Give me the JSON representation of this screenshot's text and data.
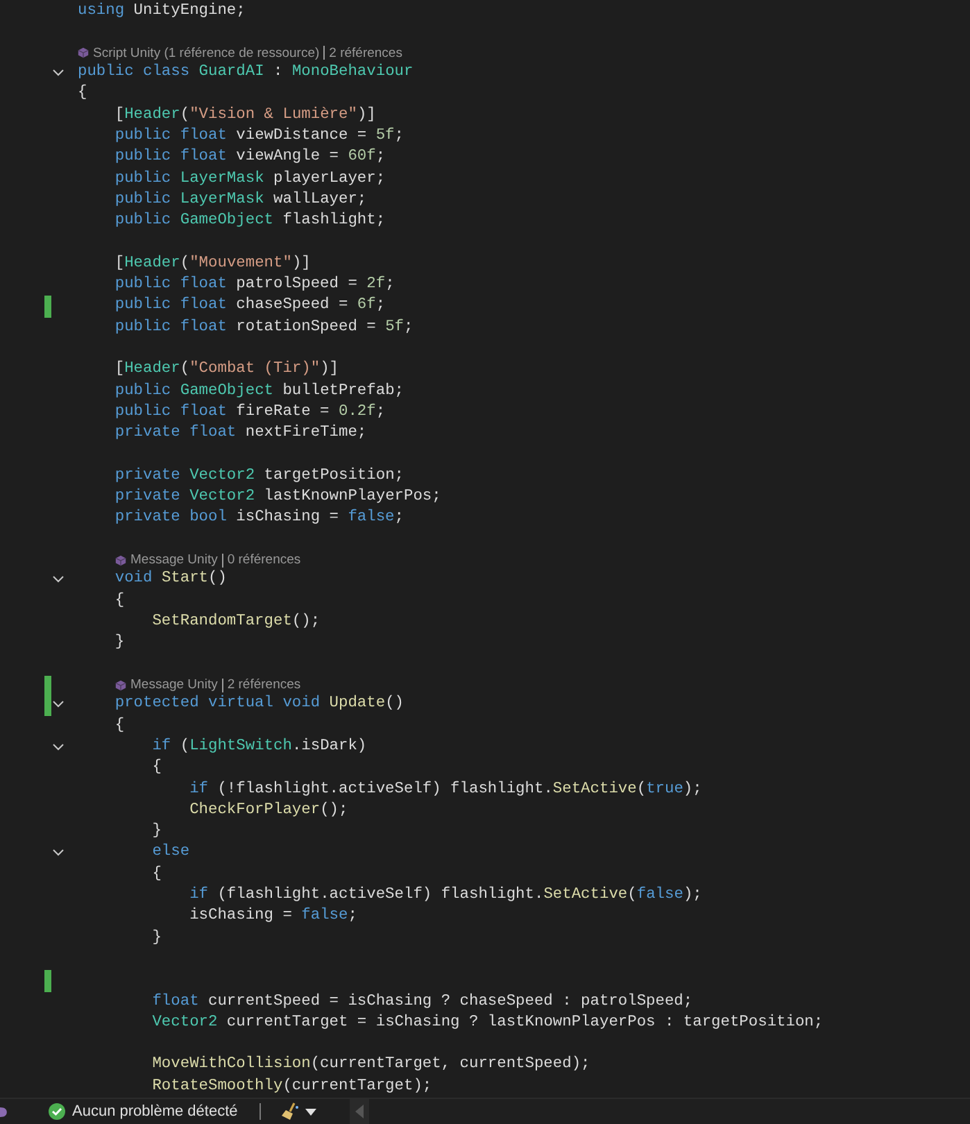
{
  "editor": {
    "lines": [
      {
        "kind": "code",
        "t": [
          {
            "kind": "kw",
            "text": "using"
          },
          {
            "kind": "text",
            "text": " UnityEngine;"
          }
        ]
      },
      {
        "kind": "blank"
      },
      {
        "kind": "lens",
        "parts": [
          "Script Unity (1 référence de ressource)",
          "2 références"
        ]
      },
      {
        "kind": "code",
        "fold": true,
        "t": [
          {
            "kind": "kw",
            "text": "public class "
          },
          {
            "kind": "type",
            "text": "GuardAI"
          },
          {
            "kind": "text",
            "text": " : "
          },
          {
            "kind": "type",
            "text": "MonoBehaviour"
          }
        ]
      },
      {
        "kind": "code",
        "t": [
          {
            "kind": "text",
            "text": "{"
          }
        ]
      },
      {
        "kind": "code",
        "t": [
          {
            "kind": "text",
            "text": "    ["
          },
          {
            "kind": "type",
            "text": "Header"
          },
          {
            "kind": "text",
            "text": "("
          },
          {
            "kind": "str",
            "text": "\"Vision & Lumière\""
          },
          {
            "kind": "text",
            "text": ")]"
          }
        ]
      },
      {
        "kind": "code",
        "t": [
          {
            "kind": "kw",
            "text": "    public float"
          },
          {
            "kind": "text",
            "text": " viewDistance = "
          },
          {
            "kind": "num",
            "text": "5f"
          },
          {
            "kind": "text",
            "text": ";"
          }
        ]
      },
      {
        "kind": "code",
        "t": [
          {
            "kind": "kw",
            "text": "    public float"
          },
          {
            "kind": "text",
            "text": " viewAngle = "
          },
          {
            "kind": "num",
            "text": "60f"
          },
          {
            "kind": "text",
            "text": ";"
          }
        ]
      },
      {
        "kind": "code",
        "t": [
          {
            "kind": "kw",
            "text": "    public "
          },
          {
            "kind": "type",
            "text": "LayerMask"
          },
          {
            "kind": "text",
            "text": " playerLayer;"
          }
        ]
      },
      {
        "kind": "code",
        "t": [
          {
            "kind": "kw",
            "text": "    public "
          },
          {
            "kind": "type",
            "text": "LayerMask"
          },
          {
            "kind": "text",
            "text": " wallLayer;"
          }
        ]
      },
      {
        "kind": "code",
        "t": [
          {
            "kind": "kw",
            "text": "    public "
          },
          {
            "kind": "type",
            "text": "GameObject"
          },
          {
            "kind": "text",
            "text": " flashlight;"
          }
        ]
      },
      {
        "kind": "blank"
      },
      {
        "kind": "code",
        "t": [
          {
            "kind": "text",
            "text": "    ["
          },
          {
            "kind": "type",
            "text": "Header"
          },
          {
            "kind": "text",
            "text": "("
          },
          {
            "kind": "str",
            "text": "\"Mouvement\""
          },
          {
            "kind": "text",
            "text": ")]"
          }
        ]
      },
      {
        "kind": "code",
        "t": [
          {
            "kind": "kw",
            "text": "    public float"
          },
          {
            "kind": "text",
            "text": " patrolSpeed = "
          },
          {
            "kind": "num",
            "text": "2f"
          },
          {
            "kind": "text",
            "text": ";"
          }
        ]
      },
      {
        "kind": "code",
        "changed": true,
        "t": [
          {
            "kind": "kw",
            "text": "    public float"
          },
          {
            "kind": "text",
            "text": " chaseSpeed = "
          },
          {
            "kind": "num",
            "text": "6f"
          },
          {
            "kind": "text",
            "text": ";"
          }
        ]
      },
      {
        "kind": "code",
        "t": [
          {
            "kind": "kw",
            "text": "    public float"
          },
          {
            "kind": "text",
            "text": " rotationSpeed = "
          },
          {
            "kind": "num",
            "text": "5f"
          },
          {
            "kind": "text",
            "text": ";"
          }
        ]
      },
      {
        "kind": "blank"
      },
      {
        "kind": "code",
        "t": [
          {
            "kind": "text",
            "text": "    ["
          },
          {
            "kind": "type",
            "text": "Header"
          },
          {
            "kind": "text",
            "text": "("
          },
          {
            "kind": "str",
            "text": "\"Combat (Tir)\""
          },
          {
            "kind": "text",
            "text": ")]"
          }
        ]
      },
      {
        "kind": "code",
        "t": [
          {
            "kind": "kw",
            "text": "    public "
          },
          {
            "kind": "type",
            "text": "GameObject"
          },
          {
            "kind": "text",
            "text": " bulletPrefab;"
          }
        ]
      },
      {
        "kind": "code",
        "t": [
          {
            "kind": "kw",
            "text": "    public float"
          },
          {
            "kind": "text",
            "text": " fireRate = "
          },
          {
            "kind": "num",
            "text": "0.2f"
          },
          {
            "kind": "text",
            "text": ";"
          }
        ]
      },
      {
        "kind": "code",
        "t": [
          {
            "kind": "kw",
            "text": "    private float"
          },
          {
            "kind": "text",
            "text": " nextFireTime;"
          }
        ]
      },
      {
        "kind": "blank"
      },
      {
        "kind": "code",
        "t": [
          {
            "kind": "kw",
            "text": "    private "
          },
          {
            "kind": "type",
            "text": "Vector2"
          },
          {
            "kind": "text",
            "text": " targetPosition;"
          }
        ]
      },
      {
        "kind": "code",
        "t": [
          {
            "kind": "kw",
            "text": "    private "
          },
          {
            "kind": "type",
            "text": "Vector2"
          },
          {
            "kind": "text",
            "text": " lastKnownPlayerPos;"
          }
        ]
      },
      {
        "kind": "code",
        "t": [
          {
            "kind": "kw",
            "text": "    private bool"
          },
          {
            "kind": "text",
            "text": " isChasing = "
          },
          {
            "kind": "kw",
            "text": "false"
          },
          {
            "kind": "text",
            "text": ";"
          }
        ]
      },
      {
        "kind": "blank"
      },
      {
        "kind": "lens",
        "parts": [
          "Message Unity",
          "0 références"
        ]
      },
      {
        "kind": "code",
        "fold": true,
        "t": [
          {
            "kind": "kw",
            "text": "    void "
          },
          {
            "kind": "fn",
            "text": "Start"
          },
          {
            "kind": "text",
            "text": "()"
          }
        ]
      },
      {
        "kind": "code",
        "t": [
          {
            "kind": "text",
            "text": "    {"
          }
        ]
      },
      {
        "kind": "code",
        "t": [
          {
            "kind": "fn",
            "text": "        SetRandomTarget"
          },
          {
            "kind": "text",
            "text": "();"
          }
        ]
      },
      {
        "kind": "code",
        "t": [
          {
            "kind": "text",
            "text": "    }"
          }
        ]
      },
      {
        "kind": "blank"
      },
      {
        "kind": "lens",
        "changed": true,
        "parts": [
          "Message Unity",
          "2 références"
        ]
      },
      {
        "kind": "code",
        "fold": true,
        "changed": true,
        "t": [
          {
            "kind": "kw",
            "text": "    protected virtual void "
          },
          {
            "kind": "fn",
            "text": "Update"
          },
          {
            "kind": "text",
            "text": "()"
          }
        ]
      },
      {
        "kind": "code",
        "t": [
          {
            "kind": "text",
            "text": "    {"
          }
        ]
      },
      {
        "kind": "code",
        "fold": true,
        "t": [
          {
            "kind": "kw",
            "text": "        if"
          },
          {
            "kind": "text",
            "text": " ("
          },
          {
            "kind": "type",
            "text": "LightSwitch"
          },
          {
            "kind": "text",
            "text": ".isDark)"
          }
        ]
      },
      {
        "kind": "code",
        "t": [
          {
            "kind": "text",
            "text": "        {"
          }
        ]
      },
      {
        "kind": "code",
        "t": [
          {
            "kind": "kw",
            "text": "            if"
          },
          {
            "kind": "text",
            "text": " (!flashlight.activeSelf) flashlight."
          },
          {
            "kind": "fn",
            "text": "SetActive"
          },
          {
            "kind": "text",
            "text": "("
          },
          {
            "kind": "kw",
            "text": "true"
          },
          {
            "kind": "text",
            "text": ");"
          }
        ]
      },
      {
        "kind": "code",
        "t": [
          {
            "kind": "fn",
            "text": "            CheckForPlayer"
          },
          {
            "kind": "text",
            "text": "();"
          }
        ]
      },
      {
        "kind": "code",
        "t": [
          {
            "kind": "text",
            "text": "        }"
          }
        ]
      },
      {
        "kind": "code",
        "fold": true,
        "t": [
          {
            "kind": "kw",
            "text": "        else"
          }
        ]
      },
      {
        "kind": "code",
        "t": [
          {
            "kind": "text",
            "text": "        {"
          }
        ]
      },
      {
        "kind": "code",
        "t": [
          {
            "kind": "kw",
            "text": "            if"
          },
          {
            "kind": "text",
            "text": " (flashlight.activeSelf) flashlight."
          },
          {
            "kind": "fn",
            "text": "SetActive"
          },
          {
            "kind": "text",
            "text": "("
          },
          {
            "kind": "kw",
            "text": "false"
          },
          {
            "kind": "text",
            "text": ");"
          }
        ]
      },
      {
        "kind": "code",
        "t": [
          {
            "kind": "text",
            "text": "            isChasing = "
          },
          {
            "kind": "kw",
            "text": "false"
          },
          {
            "kind": "text",
            "text": ";"
          }
        ]
      },
      {
        "kind": "code",
        "t": [
          {
            "kind": "text",
            "text": "        }"
          }
        ]
      },
      {
        "kind": "blank"
      },
      {
        "kind": "blank",
        "changed": true
      },
      {
        "kind": "code",
        "t": [
          {
            "kind": "kw",
            "text": "        float"
          },
          {
            "kind": "text",
            "text": " currentSpeed = isChasing ? chaseSpeed : patrolSpeed;"
          }
        ]
      },
      {
        "kind": "code",
        "t": [
          {
            "kind": "type",
            "text": "        Vector2"
          },
          {
            "kind": "text",
            "text": " currentTarget = isChasing ? lastKnownPlayerPos : targetPosition;"
          }
        ]
      },
      {
        "kind": "blank"
      },
      {
        "kind": "code",
        "t": [
          {
            "kind": "fn",
            "text": "        MoveWithCollision"
          },
          {
            "kind": "text",
            "text": "(currentTarget, currentSpeed);"
          }
        ]
      },
      {
        "kind": "code",
        "t": [
          {
            "kind": "fn",
            "text": "        RotateSmoothly"
          },
          {
            "kind": "text",
            "text": "(currentTarget);"
          }
        ]
      }
    ]
  },
  "status_bar": {
    "message": "Aucun problème détecté"
  }
}
